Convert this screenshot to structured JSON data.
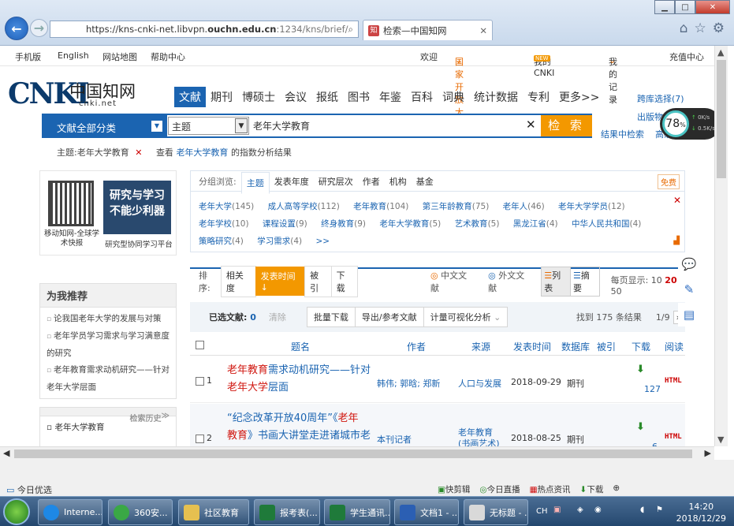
{
  "browser": {
    "url_prefix": "https://kns-cnki-net.libvpn.",
    "url_domain": "ouchn.edu.cn",
    "url_rest": ":1234/kns/brief/",
    "tab_title": "检索—中国知网",
    "tab_icon": "知"
  },
  "topnav": {
    "mobile": "手机版",
    "english": "English",
    "sitemap": "网站地图",
    "help": "帮助中心",
    "welcome": "欢迎",
    "institution": "国家开放大学",
    "mycnki": "我的CNKI",
    "new_badge": "NEW",
    "records": "我的记录",
    "recharge": "充值中心"
  },
  "logo": {
    "mark": "CNKI",
    "zh": "中国知网",
    "domain": "cnki.net"
  },
  "categories": [
    "文献",
    "期刊",
    "博硕士",
    "会议",
    "报纸",
    "图书",
    "年鉴",
    "百科",
    "词典",
    "统计数据",
    "专利",
    "更多>>"
  ],
  "right_links": [
    "跨库选择(7)",
    "出版物检索"
  ],
  "search": {
    "category": "文献全部分类",
    "field": "主题",
    "query": "老年大学教育",
    "button": "检 索",
    "within": "结果中检索",
    "advanced": "高级检索"
  },
  "crumb": {
    "condition": "主题:老年大学教育",
    "view_prefix": "查看",
    "term": "老年大学教育",
    "view_suffix": "的指数分析结果"
  },
  "promo": {
    "qr_caption": "移动知网-全球学术快报",
    "ad_line1": "研究与学习",
    "ad_line2": "不能少利器",
    "ad_caption": "研究型协同学习平台"
  },
  "recommend": {
    "title": "为我推荐",
    "items": [
      "论我国老年大学的发展与对策",
      "老年学员学习需求与学习满意度的研究",
      "老年教育需求动机研究——针对老年大学层面"
    ]
  },
  "history": {
    "title": "检索历史",
    "items": [
      "老年大学教育"
    ]
  },
  "grouping": {
    "label": "分组浏览:",
    "tabs": [
      "主题",
      "发表年度",
      "研究层次",
      "作者",
      "机构",
      "基金"
    ],
    "free": "免费",
    "values": [
      {
        "name": "老年大学",
        "count": "(145)"
      },
      {
        "name": "成人高等学校",
        "count": "(112)"
      },
      {
        "name": "老年教育",
        "count": "(104)"
      },
      {
        "name": "第三年龄教育",
        "count": "(75)"
      },
      {
        "name": "老年人",
        "count": "(46)"
      },
      {
        "name": "老年大学学员",
        "count": "(12)"
      },
      {
        "name": "老年学校",
        "count": "(10)"
      },
      {
        "name": "课程设置",
        "count": "(9)"
      },
      {
        "name": "终身教育",
        "count": "(9)"
      },
      {
        "name": "老年大学教育",
        "count": "(5)"
      },
      {
        "name": "艺术教育",
        "count": "(5)"
      },
      {
        "name": "黑龙江省",
        "count": "(4)"
      },
      {
        "name": "中华人民共和国",
        "count": "(4)"
      },
      {
        "name": "策略研究",
        "count": "(4)"
      },
      {
        "name": "学习需求",
        "count": "(4)"
      },
      {
        "name": ">>",
        "count": ""
      }
    ]
  },
  "sort": {
    "label": "排序:",
    "options": [
      "相关度",
      "发表时间",
      "被引",
      "下载"
    ],
    "zh_docs": "中文文献",
    "foreign_docs": "外文文献",
    "list_view": "列表",
    "abstract_view": "摘要",
    "per_page_label": "每页显示:",
    "per_page": [
      "10",
      "20",
      "50"
    ]
  },
  "ops": {
    "selected_label": "已选文献:",
    "selected_count": "0",
    "clear": "清除",
    "batch": "批量下载",
    "export": "导出/参考文献",
    "visual": "计量可视化分析",
    "total": "找到 175 条结果",
    "page": "1/9"
  },
  "table": {
    "headers": [
      "题名",
      "作者",
      "来源",
      "发表时间",
      "数据库",
      "被引",
      "下载",
      "阅读"
    ],
    "rows": [
      {
        "num": "1",
        "title_a": "老年教育",
        "title_b": "需求动机研究——针对",
        "title_c": "老年大学",
        "title_d": "层面",
        "authors": "韩伟; 郭晗; 郑新",
        "source": "人口与发展",
        "date": "2018-09-29",
        "db": "期刊",
        "downloads": "127",
        "read": "HTML"
      },
      {
        "num": "2",
        "title_a": "“纪念改革开放40周年”《",
        "title_b": "老年",
        "title_c": "教育",
        "title_d": "》书画大讲堂走进诸城市老",
        "authors": "本刊记者",
        "source": "老年教育(书画艺术)",
        "date": "2018-08-25",
        "db": "期刊",
        "downloads": "6",
        "read": "HTML"
      }
    ]
  },
  "speed": {
    "percent": "78",
    "unit": "%",
    "up": "0K/s",
    "down": "0.5K/s"
  },
  "status": {
    "left": "今日优选",
    "items": [
      "快剪辑",
      "今日直播",
      "热点资讯",
      "下载"
    ]
  },
  "taskbar": {
    "tasks": [
      "Interne...",
      "360安...",
      "社区教育",
      "报考表(...",
      "学生通讯...",
      "文档1 - ...",
      "无标题 - ..."
    ],
    "time": "14:20",
    "date": "2018/12/29"
  }
}
